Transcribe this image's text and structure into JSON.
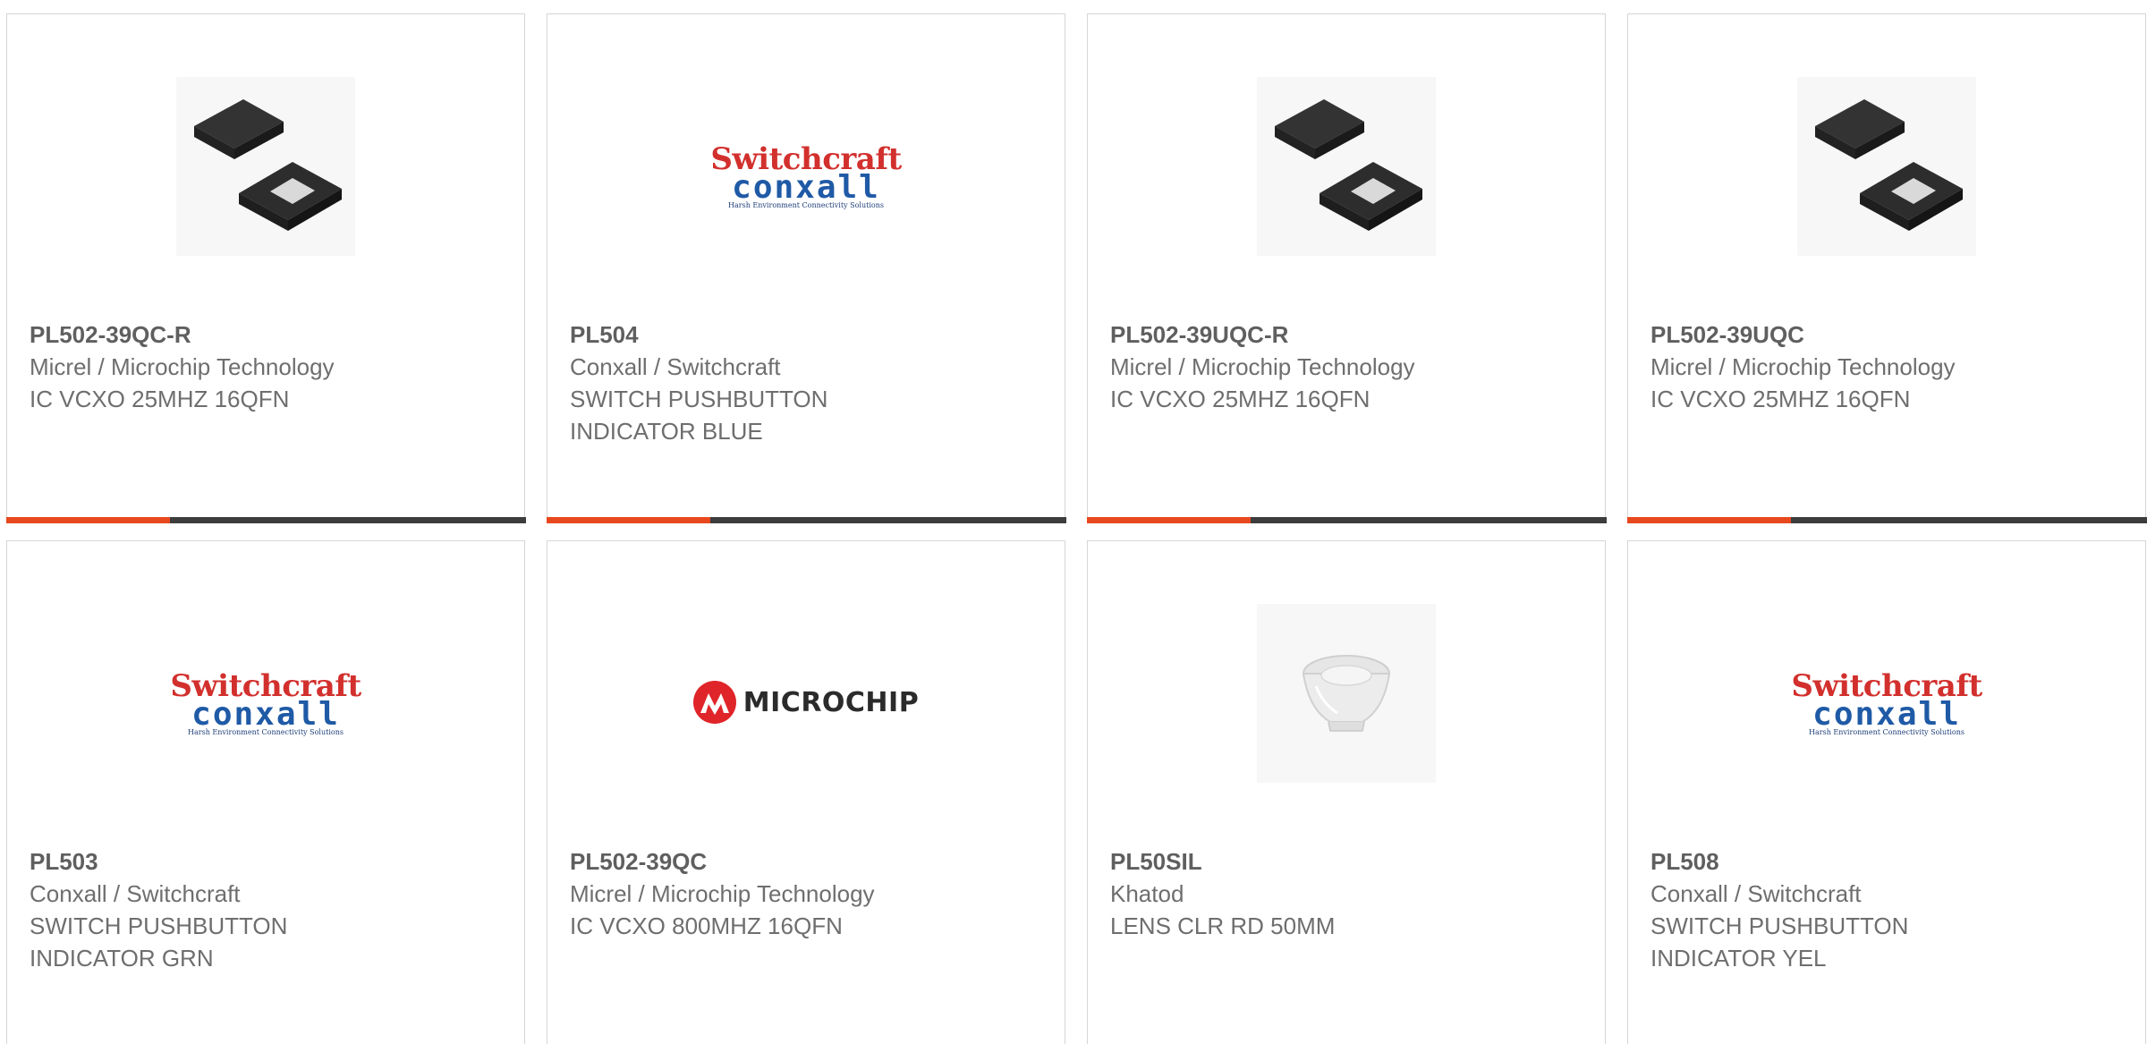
{
  "products": [
    {
      "part": "PL502-39QC-R",
      "manufacturer": "Micrel / Microchip Technology",
      "description": "IC VCXO 25MHZ 16QFN",
      "image": "qfn-chip-icon"
    },
    {
      "part": "PL504",
      "manufacturer": "Conxall / Switchcraft",
      "description": "SWITCH PUSHBUTTON INDICATOR BLUE",
      "image": "switchcraft-conxall-logo"
    },
    {
      "part": "PL502-39UQC-R",
      "manufacturer": "Micrel / Microchip Technology",
      "description": "IC VCXO 25MHZ 16QFN",
      "image": "qfn-chip-icon"
    },
    {
      "part": "PL502-39UQC",
      "manufacturer": "Micrel / Microchip Technology",
      "description": "IC VCXO 25MHZ 16QFN",
      "image": "qfn-chip-icon"
    },
    {
      "part": "PL503",
      "manufacturer": "Conxall / Switchcraft",
      "description": "SWITCH PUSHBUTTON INDICATOR GRN",
      "image": "switchcraft-conxall-logo"
    },
    {
      "part": "PL502-39QC",
      "manufacturer": "Micrel / Microchip Technology",
      "description": "IC VCXO 800MHZ 16QFN",
      "image": "microchip-logo"
    },
    {
      "part": "PL50SIL",
      "manufacturer": "Khatod",
      "description": "LENS CLR RD 50MM",
      "image": "clear-lens-icon"
    },
    {
      "part": "PL508",
      "manufacturer": "Conxall / Switchcraft",
      "description": "SWITCH PUSHBUTTON INDICATOR YEL",
      "image": "switchcraft-conxall-logo"
    }
  ],
  "logos": {
    "switchcraft": "Switchcraft",
    "conxall": "conxall",
    "conxall_tagline": "Harsh Environment Connectivity Solutions",
    "microchip": "MICROCHIP"
  },
  "colors": {
    "accent": "#e8481e",
    "bar": "#3d3d3d",
    "text": "#6e6e6e",
    "border": "#d6d6d6"
  }
}
